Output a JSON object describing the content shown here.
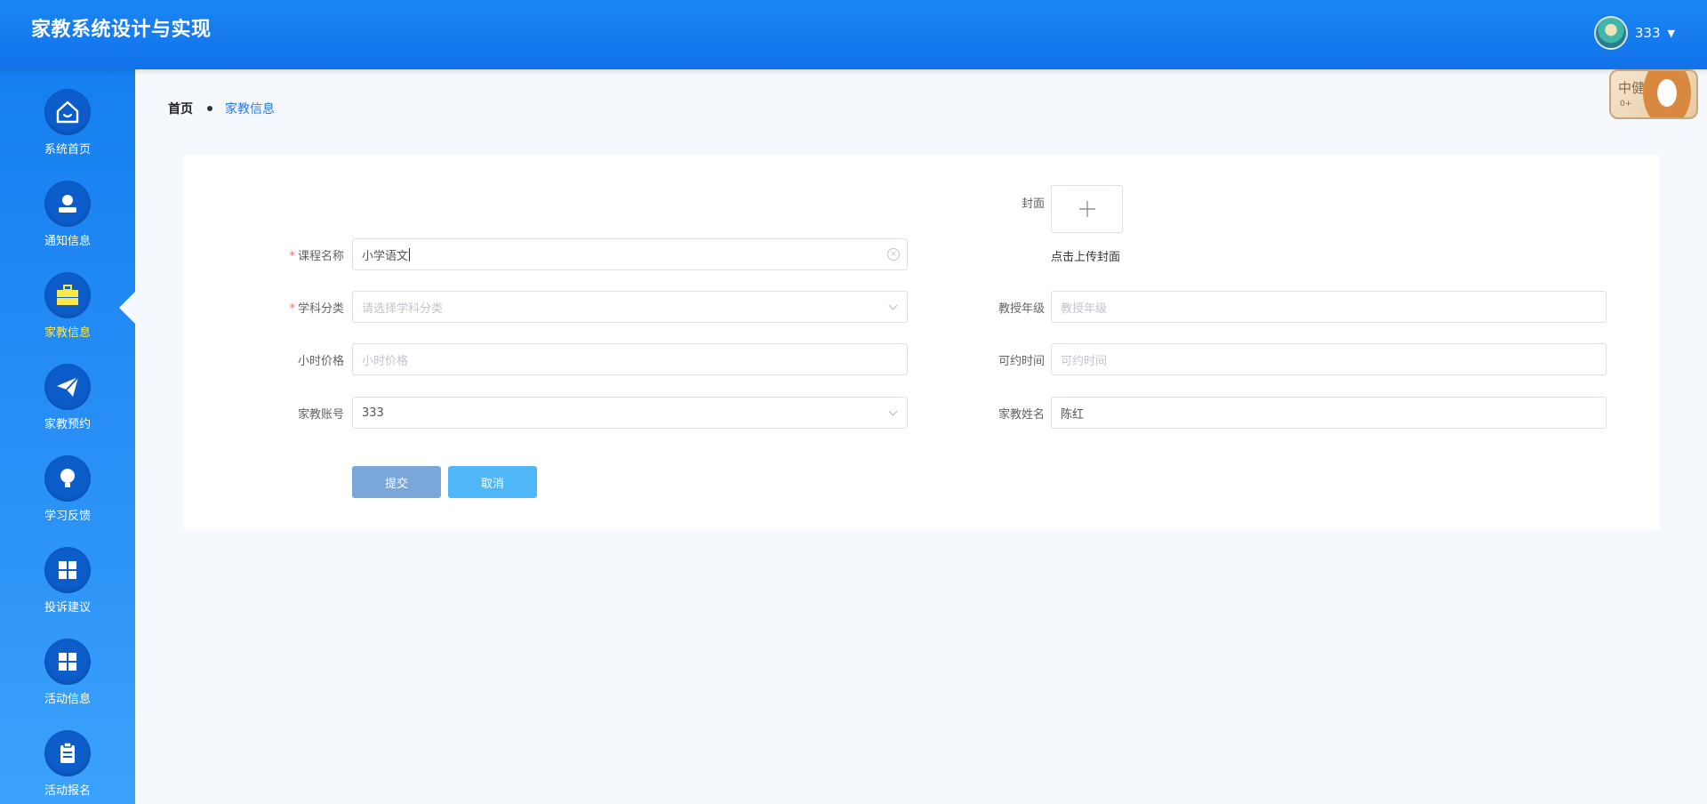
{
  "header": {
    "title": "家教系统设计与实现",
    "username": "333"
  },
  "mascot": {
    "text": "中健",
    "sub_text": "0+"
  },
  "sidebar": {
    "items": [
      {
        "label": "系统首页",
        "icon": "home-icon"
      },
      {
        "label": "通知信息",
        "icon": "user-icon"
      },
      {
        "label": "家教信息",
        "icon": "briefcase-icon",
        "active": true
      },
      {
        "label": "家教预约",
        "icon": "paper-plane-icon"
      },
      {
        "label": "学习反馈",
        "icon": "lightbulb-icon"
      },
      {
        "label": "投诉建议",
        "icon": "grid-icon"
      },
      {
        "label": "活动信息",
        "icon": "grid-icon"
      },
      {
        "label": "活动报名",
        "icon": "clipboard-icon"
      }
    ]
  },
  "breadcrumb": {
    "home": "首页",
    "current": "家教信息"
  },
  "form": {
    "cover_label": "封面",
    "cover_hint": "点击上传封面",
    "course_name_label": "课程名称",
    "course_name_value": "小学语文",
    "subject_label": "学科分类",
    "subject_placeholder": "请选择学科分类",
    "grade_label": "教授年级",
    "grade_placeholder": "教授年级",
    "price_label": "小时价格",
    "price_placeholder": "小时价格",
    "time_label": "可约时间",
    "time_placeholder": "可约时间",
    "account_label": "家教账号",
    "account_value": "333",
    "tutor_name_label": "家教姓名",
    "tutor_name_value": "陈红",
    "submit_label": "提交",
    "cancel_label": "取消"
  },
  "colors": {
    "header": "#1272ea",
    "sidebar": "#167ff0",
    "active_nav_text": "#ffe94a",
    "submit_button": "#7aa6da",
    "cancel_button": "#4fb6f8",
    "required_star": "#f56c6c"
  }
}
